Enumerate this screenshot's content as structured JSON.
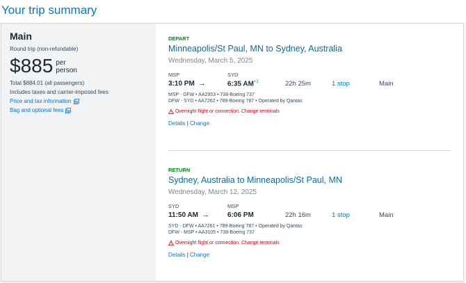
{
  "page": {
    "title": "Your trip summary"
  },
  "summary": {
    "fare_name": "Main",
    "trip_type": "Round trip (non-refundable)",
    "price": "$885",
    "per_person": "per person",
    "total": "Total $884.01 (all passengers)",
    "taxes": "Includes taxes and carrier-imposed fees",
    "price_tax_link": "Price and tax information",
    "bag_link": "Bag and optional fees"
  },
  "depart": {
    "label": "DEPART",
    "route": "Minneapolis/St Paul, MN to Sydney, Australia",
    "date": "Wednesday, March 5, 2025",
    "origin_code": "MSP",
    "dest_code": "SYD",
    "depart_time": "3:10 PM",
    "arrow": "→",
    "arrive_time": "6:35 AM",
    "day_offset": "+2",
    "duration": "22h 25m",
    "stops": "1 stop",
    "cabin": "Main",
    "segments": [
      "MSP - DFW • AA2953 • 738-Boeing 737",
      "DFW - SYD • AA7262 • 789-Boeing 787 • Operated by Qantas"
    ],
    "warning": "Overnight flight or connection. Change terminals",
    "details": "Details",
    "separator": "|",
    "change": "Change"
  },
  "return": {
    "label": "RETURN",
    "route": "Sydney, Australia to Minneapolis/St Paul, MN",
    "date": "Wednesday, March 12, 2025",
    "origin_code": "SYD",
    "dest_code": "MSP",
    "depart_time": "11:50 AM",
    "arrow": "→",
    "arrive_time": "6:06 PM",
    "duration": "22h 16m",
    "stops": "1 stop",
    "cabin": "Main",
    "segments": [
      "SYD - DFW • AA7261 • 789-Boeing 787 • Operated by Qantas",
      "DFW - MSP • AA3105 • 738-Boeing 737"
    ],
    "warning": "Overnight flight or connection. Change terminals",
    "details": "Details",
    "separator": "|",
    "change": "Change"
  },
  "colors": {
    "brand_blue": "#0078d2",
    "route_blue": "#0b6aa2",
    "depart_green": "#008712",
    "warning_red": "#c30019",
    "summary_bg": "#f1f3f4"
  },
  "icons": {
    "external_link": "external-link-icon",
    "warning": "warning-triangle-icon",
    "arrow": "right-arrow-icon"
  }
}
